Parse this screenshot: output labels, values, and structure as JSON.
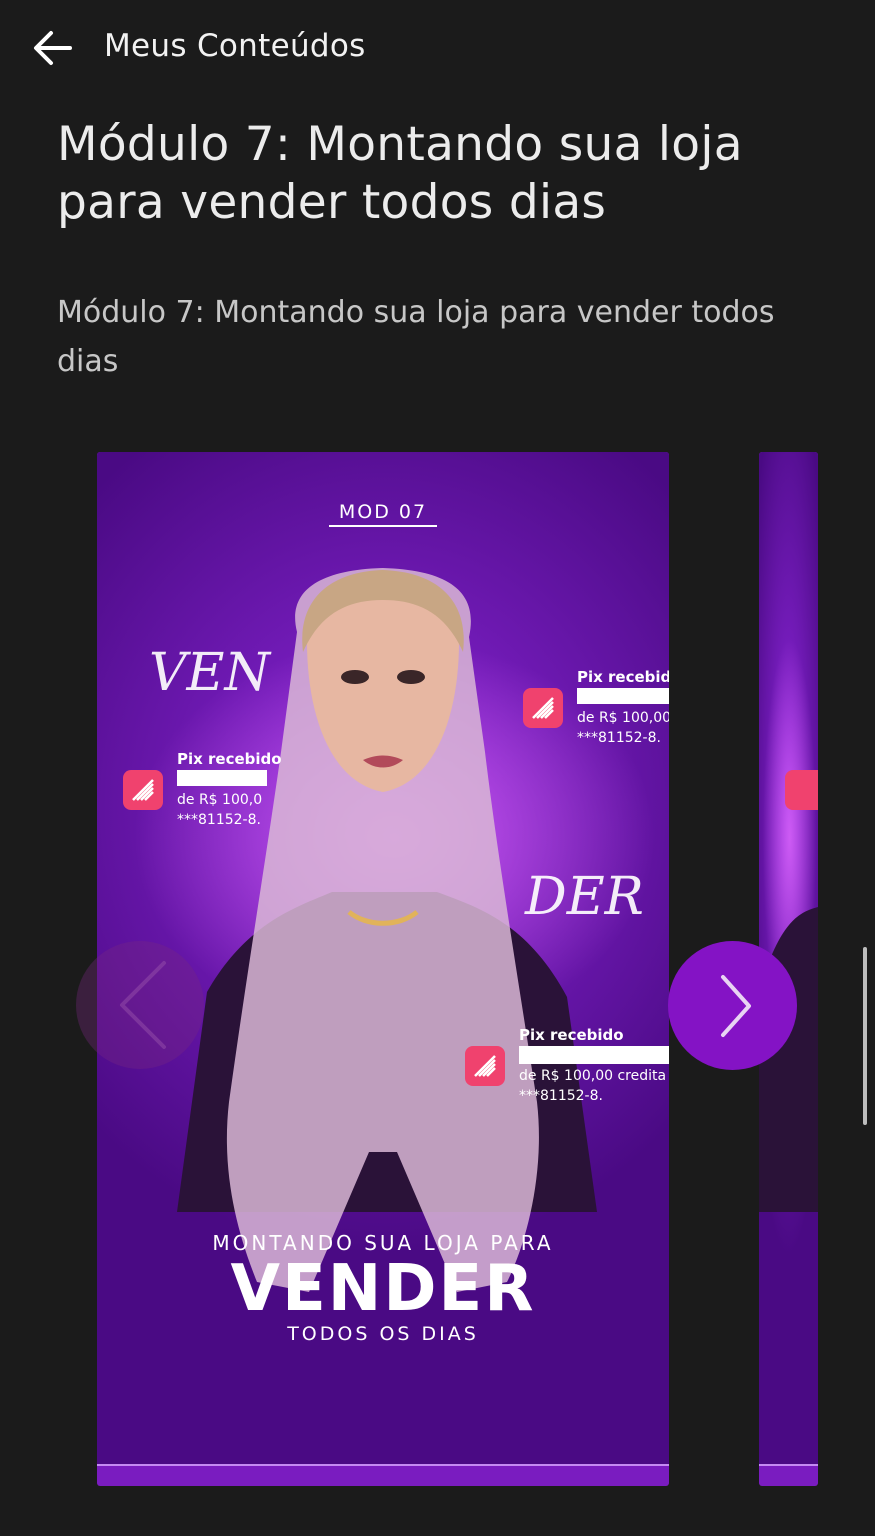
{
  "header": {
    "title": "Meus Conteúdos"
  },
  "module": {
    "title": "Módulo 7: Montando sua loja para vender todos dias",
    "description": "Módulo 7: Montando sua loja para vender todos dias"
  },
  "cover": {
    "tag": "MOD 07",
    "script_word_1": "VEN",
    "script_word_2": "DER",
    "headline_top": "MONTANDO SUA LOJA PARA",
    "headline_main": "VENDER",
    "headline_bottom": "TODOS OS DIAS",
    "notifications": [
      {
        "title": "Pix recebido",
        "line1": "de R$ 100,0",
        "line2": "***81152-8."
      },
      {
        "title": "Pix recebido",
        "line1": "de R$ 100,00",
        "line2": "***81152-8."
      },
      {
        "title": "Pix recebido",
        "line1": "de R$ 100,00 credita",
        "line2": "***81152-8."
      }
    ]
  },
  "colors": {
    "background": "#1b1b1b",
    "accent": "#8413c5",
    "pix_icon": "#f0426e"
  },
  "icons": {
    "back": "arrow-left-icon",
    "next": "chevron-right-icon",
    "prev": "chevron-left-icon",
    "pix": "pix-icon"
  }
}
